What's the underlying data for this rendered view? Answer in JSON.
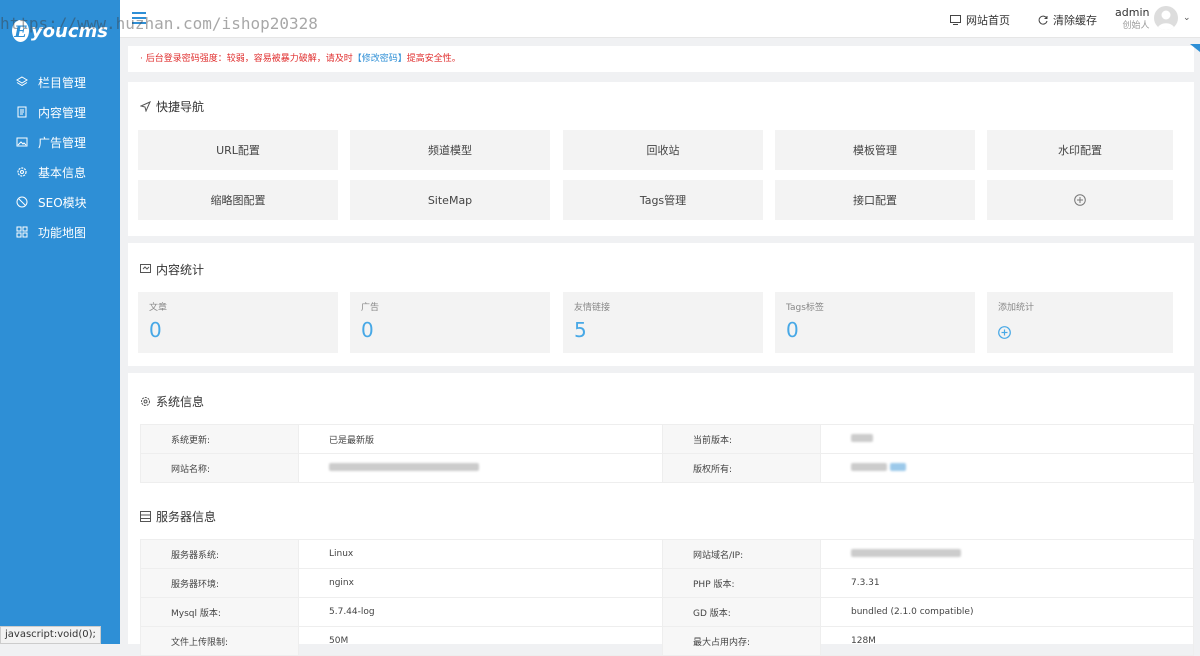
{
  "watermark": "https://www.huzhan.com/ishop20328",
  "logo": {
    "letter": "E",
    "text": "youcms"
  },
  "sidebar": {
    "items": [
      {
        "label": "栏目管理",
        "icon": "layers-icon"
      },
      {
        "label": "内容管理",
        "icon": "document-icon"
      },
      {
        "label": "广告管理",
        "icon": "image-icon"
      },
      {
        "label": "基本信息",
        "icon": "gear-icon"
      },
      {
        "label": "SEO模块",
        "icon": "seo-icon"
      },
      {
        "label": "功能地图",
        "icon": "grid-icon"
      }
    ]
  },
  "header": {
    "site_home": "网站首页",
    "clear_cache": "清除缓存",
    "username": "admin",
    "role": "创始人"
  },
  "alert": {
    "prefix": "· 后台登录密码强度：较弱，容易被暴力破解，请及时",
    "link": "【修改密码】",
    "suffix": "提高安全性。"
  },
  "quick_nav": {
    "title": "快捷导航",
    "items": [
      "URL配置",
      "频道模型",
      "回收站",
      "模板管理",
      "水印配置",
      "缩略图配置",
      "SiteMap",
      "Tags管理",
      "接口配置"
    ]
  },
  "stats": {
    "title": "内容统计",
    "items": [
      {
        "label": "文章",
        "value": "0"
      },
      {
        "label": "广告",
        "value": "0"
      },
      {
        "label": "友情链接",
        "value": "5"
      },
      {
        "label": "Tags标签",
        "value": "0"
      }
    ],
    "add_label": "添加统计"
  },
  "system": {
    "title": "系统信息",
    "rows": [
      {
        "k1": "系统更新:",
        "v1": "已是最新版",
        "k2": "当前版本:"
      },
      {
        "k1": "网站名称:",
        "k2": "版权所有:"
      }
    ]
  },
  "server": {
    "title": "服务器信息",
    "rows": [
      {
        "k1": "服务器系统:",
        "v1": "Linux",
        "k2": "网站域名/IP:",
        "v2": ""
      },
      {
        "k1": "服务器环境:",
        "v1": "nginx",
        "k2": "PHP 版本:",
        "v2": "7.3.31"
      },
      {
        "k1": "Mysql 版本:",
        "v1": "5.7.44-log",
        "k2": "GD 版本:",
        "v2": "bundled (2.1.0 compatible)"
      },
      {
        "k1": "文件上传限制:",
        "v1": "50M",
        "k2": "最大占用内存:",
        "v2": "128M"
      }
    ]
  },
  "statusbar": "javascript:void(0);"
}
